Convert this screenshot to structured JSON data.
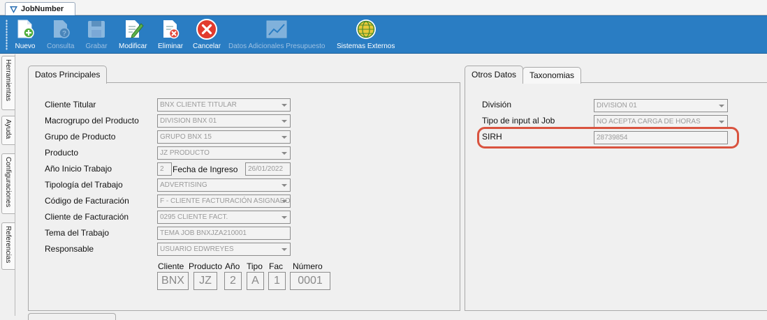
{
  "window": {
    "tab_title": "JobNumber"
  },
  "toolbar": {
    "buttons": [
      {
        "label": "Nuevo",
        "icon": "new-document-icon",
        "enabled": true
      },
      {
        "label": "Consulta",
        "icon": "query-document-icon",
        "enabled": false
      },
      {
        "label": "Grabar",
        "icon": "save-disk-icon",
        "enabled": false
      },
      {
        "label": "Modificar",
        "icon": "edit-document-icon",
        "enabled": true
      },
      {
        "label": "Eliminar",
        "icon": "delete-document-icon",
        "enabled": true
      },
      {
        "label": "Cancelar",
        "icon": "cancel-icon",
        "enabled": true
      },
      {
        "label": "Datos Adicionales Presupuesto",
        "icon": "chart-icon",
        "enabled": false
      },
      {
        "label": "Sistemas Externos",
        "icon": "globe-icon",
        "enabled": true
      }
    ]
  },
  "side_tabs": [
    "Herramientas",
    "Ayuda",
    "Configuraciones",
    "Referencias"
  ],
  "main_panel": {
    "tab": "Datos Principales",
    "fields": [
      {
        "label": "Cliente Titular",
        "value": "BNX CLIENTE TITULAR",
        "dropdown": true
      },
      {
        "label": "Macrogrupo del Producto",
        "value": "DIVISION BNX 01",
        "dropdown": true
      },
      {
        "label": "Grupo de Producto",
        "value": "GRUPO BNX 15",
        "dropdown": true
      },
      {
        "label": "Producto",
        "value": "JZ PRODUCTO",
        "dropdown": true
      },
      {
        "label": "Año Inicio Trabajo",
        "value": "2"
      },
      {
        "label": "Tipología del Trabajo",
        "value": "ADVERTISING",
        "dropdown": true
      },
      {
        "label": "Código de Facturación",
        "value": "F - CLIENTE FACTURACIÓN ASIGNADO",
        "dropdown": true
      },
      {
        "label": "Cliente de Facturación",
        "value": "0295 CLIENTE FACT.",
        "dropdown": true
      },
      {
        "label": "Tema del Trabajo",
        "value": "TEMA JOB BNXJZA210001"
      },
      {
        "label": "Responsable",
        "value": "USUARIO EDWREYES",
        "dropdown": true
      }
    ],
    "fecha_ingreso": {
      "label": "Fecha de Ingreso",
      "value": "26/01/2022"
    },
    "job_code": {
      "labels": [
        "Cliente",
        "Producto",
        "Año",
        "Tipo",
        "Fac",
        "Número"
      ],
      "values": [
        "BNX",
        "JZ",
        "2",
        "A",
        "1",
        "0001"
      ]
    }
  },
  "side_panel": {
    "tabs": [
      "Otros Datos",
      "Taxonomias"
    ],
    "fields": [
      {
        "label": "División",
        "value": "DIVISION 01",
        "dropdown": true
      },
      {
        "label": "Tipo de input al Job",
        "value": "NO ACEPTA CARGA DE HORAS",
        "dropdown": true
      },
      {
        "label": "SIRH",
        "value": "28739854"
      }
    ],
    "highlight_color": "#d9533f"
  },
  "colors": {
    "ribbon": "#2a7dc3",
    "panel_bg": "#f0f0f0"
  }
}
